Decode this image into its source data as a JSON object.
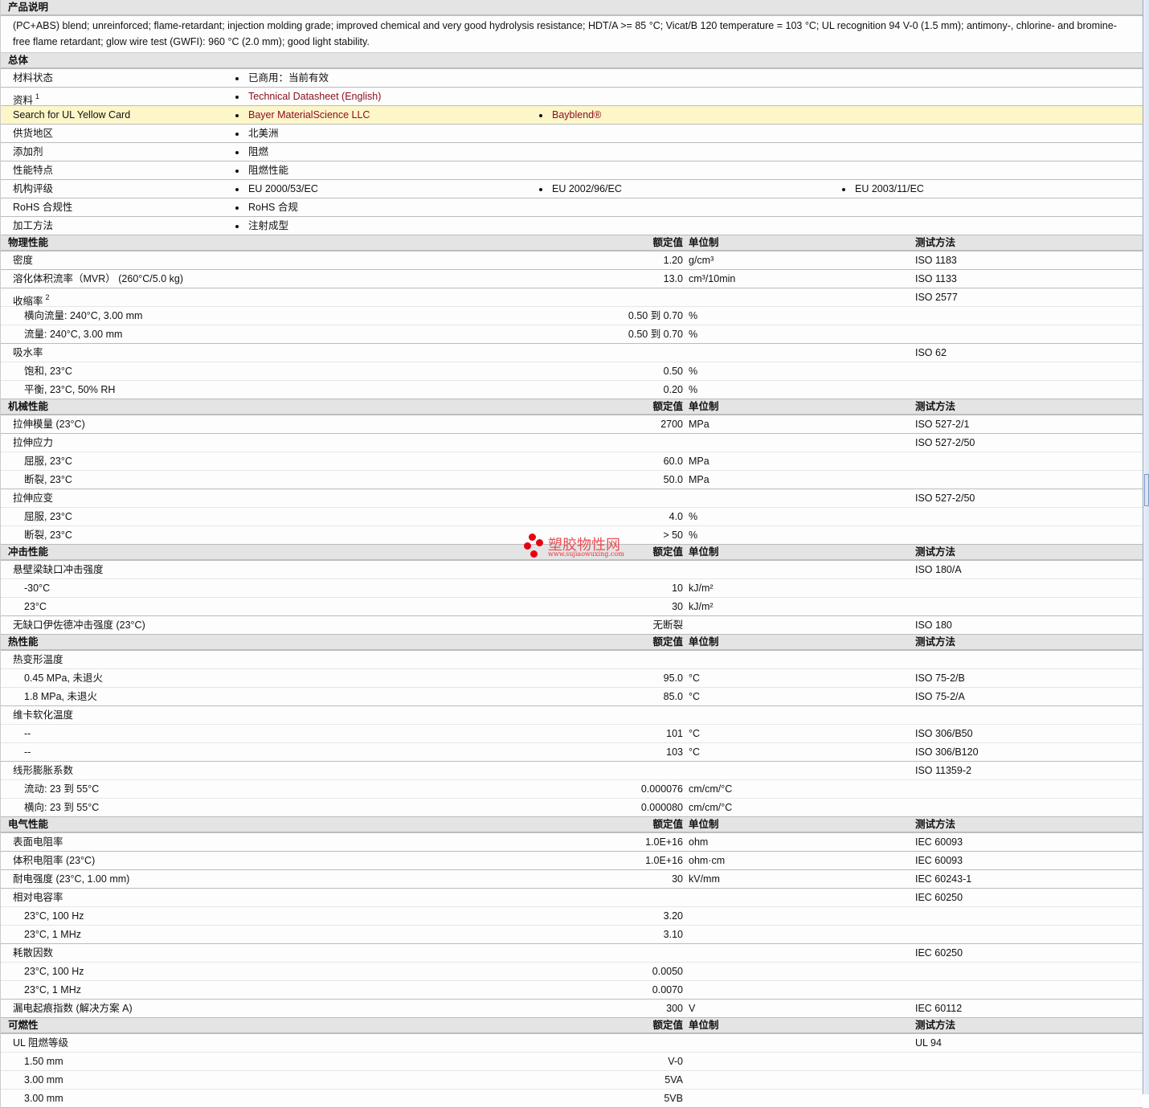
{
  "product_description": {
    "title": "产品说明",
    "text": "(PC+ABS) blend; unreinforced; flame-retardant; injection molding grade; improved chemical and very good hydrolysis resistance; HDT/A >= 85 °C; Vicat/B 120 temperature = 103 °C; UL recognition 94 V-0 (1.5 mm); antimony-, chlorine- and bromine-free flame retardant; glow wire test (GWFI): 960 °C (2.0 mm); good light stability."
  },
  "general": {
    "title": "总体",
    "rows": [
      {
        "label": "材料状态",
        "items": [
          "已商用：当前有效"
        ]
      },
      {
        "label": "资料",
        "sup": "1",
        "items": [
          "Technical Datasheet (English)"
        ],
        "link": true
      },
      {
        "label": "Search for UL Yellow Card",
        "items": [
          "Bayer MaterialScience LLC",
          "Bayblend®"
        ],
        "link": true,
        "highlight": true
      },
      {
        "label": "供货地区",
        "items": [
          "北美洲"
        ]
      },
      {
        "label": "添加剂",
        "items": [
          "阻燃"
        ]
      },
      {
        "label": "性能特点",
        "items": [
          "阻燃性能"
        ]
      },
      {
        "label": "机构评级",
        "items": [
          "EU 2000/53/EC",
          "EU 2002/96/EC",
          "EU 2003/11/EC"
        ]
      },
      {
        "label": "RoHS 合规性",
        "items": [
          "RoHS 合规"
        ]
      },
      {
        "label": "加工方法",
        "items": [
          "注射成型"
        ]
      }
    ]
  },
  "column_headers": {
    "value": "额定值",
    "unit": "单位制",
    "test": "测试方法"
  },
  "sections": [
    {
      "title": "物理性能",
      "rows": [
        {
          "label": "密度",
          "value": "1.20",
          "unit": "g/cm³",
          "test": "ISO 1183"
        },
        {
          "label": "溶化体积流率（MVR）  (260°C/5.0 kg)",
          "value": "13.0",
          "unit": "cm³/10min",
          "test": "ISO 1133"
        },
        {
          "label": "收缩率",
          "sup": "2",
          "test": "ISO 2577",
          "group": true
        },
        {
          "label": "横向流量: 240°C, 3.00 mm",
          "value": "0.50 到  0.70",
          "unit": "%",
          "sub": true
        },
        {
          "label": "流量: 240°C, 3.00 mm",
          "value": "0.50 到  0.70",
          "unit": "%",
          "sub": true
        },
        {
          "label": "吸水率",
          "test": "ISO 62",
          "group": true
        },
        {
          "label": "饱和, 23°C",
          "value": "0.50",
          "unit": "%",
          "sub": true
        },
        {
          "label": "平衡, 23°C, 50% RH",
          "value": "0.20",
          "unit": "%",
          "sub": true
        }
      ]
    },
    {
      "title": "机械性能",
      "rows": [
        {
          "label": "拉伸模量  (23°C)",
          "value": "2700",
          "unit": "MPa",
          "test": "ISO 527-2/1"
        },
        {
          "label": "拉伸应力",
          "test": "ISO 527-2/50",
          "group": true
        },
        {
          "label": "屈服, 23°C",
          "value": "60.0",
          "unit": "MPa",
          "sub": true
        },
        {
          "label": "断裂, 23°C",
          "value": "50.0",
          "unit": "MPa",
          "sub": true
        },
        {
          "label": "拉伸应变",
          "test": "ISO 527-2/50",
          "group": true
        },
        {
          "label": "屈服, 23°C",
          "value": "4.0",
          "unit": "%",
          "sub": true
        },
        {
          "label": "断裂, 23°C",
          "value": "> 50",
          "unit": "%",
          "sub": true
        }
      ]
    },
    {
      "title": "冲击性能",
      "rows": [
        {
          "label": "悬壁梁缺口冲击强度",
          "test": "ISO 180/A",
          "group": true
        },
        {
          "label": "-30°C",
          "value": "10",
          "unit": "kJ/m²",
          "sub": true
        },
        {
          "label": "23°C",
          "value": "30",
          "unit": "kJ/m²",
          "sub": true
        },
        {
          "label": "无缺口伊佐德冲击强度  (23°C)",
          "value": "无断裂",
          "test": "ISO 180"
        }
      ]
    },
    {
      "title": "热性能",
      "rows": [
        {
          "label": "热变形温度",
          "group": true
        },
        {
          "label": "0.45 MPa, 未退火",
          "value": "95.0",
          "unit": "°C",
          "test": "ISO 75-2/B",
          "sub": true
        },
        {
          "label": "1.8 MPa, 未退火",
          "value": "85.0",
          "unit": "°C",
          "test": "ISO 75-2/A",
          "sub": true
        },
        {
          "label": "维卡软化温度",
          "group": true
        },
        {
          "label": "--",
          "value": "101",
          "unit": "°C",
          "test": "ISO 306/B50",
          "sub": true
        },
        {
          "label": "--",
          "value": "103",
          "unit": "°C",
          "test": "ISO 306/B120",
          "sub": true
        },
        {
          "label": "线形膨胀系数",
          "test": "ISO 11359-2",
          "group": true
        },
        {
          "label": "流动: 23 到  55°C",
          "value": "0.000076",
          "unit": "cm/cm/°C",
          "sub": true
        },
        {
          "label": "横向: 23 到  55°C",
          "value": "0.000080",
          "unit": "cm/cm/°C",
          "sub": true
        }
      ]
    },
    {
      "title": "电气性能",
      "rows": [
        {
          "label": "表面电阻率",
          "value": "1.0E+16",
          "unit": "ohm",
          "test": "IEC 60093"
        },
        {
          "label": "体积电阻率  (23°C)",
          "value": "1.0E+16",
          "unit": "ohm·cm",
          "test": "IEC 60093"
        },
        {
          "label": "耐电强度  (23°C, 1.00 mm)",
          "value": "30",
          "unit": "kV/mm",
          "test": "IEC 60243-1"
        },
        {
          "label": "相对电容率",
          "test": "IEC 60250",
          "group": true
        },
        {
          "label": "23°C, 100 Hz",
          "value": "3.20",
          "sub": true
        },
        {
          "label": "23°C, 1 MHz",
          "value": "3.10",
          "sub": true
        },
        {
          "label": "耗散因数",
          "test": "IEC 60250",
          "group": true
        },
        {
          "label": "23°C, 100 Hz",
          "value": "0.0050",
          "sub": true
        },
        {
          "label": "23°C, 1 MHz",
          "value": "0.0070",
          "sub": true
        },
        {
          "label": "漏电起痕指数  (解决方案  A)",
          "value": "300",
          "unit": "V",
          "test": "IEC 60112"
        }
      ]
    },
    {
      "title": "可燃性",
      "rows": [
        {
          "label": "UL 阻燃等级",
          "test": "UL 94",
          "group": true
        },
        {
          "label": "1.50 mm",
          "value": "V-0",
          "sub": true
        },
        {
          "label": "3.00 mm",
          "value": "5VA",
          "sub": true
        },
        {
          "label": "3.00 mm",
          "value": "5VB",
          "sub": true
        }
      ]
    }
  ],
  "watermark": {
    "name": "塑胶物性网",
    "url": "www.sujiaowuxing.com"
  }
}
